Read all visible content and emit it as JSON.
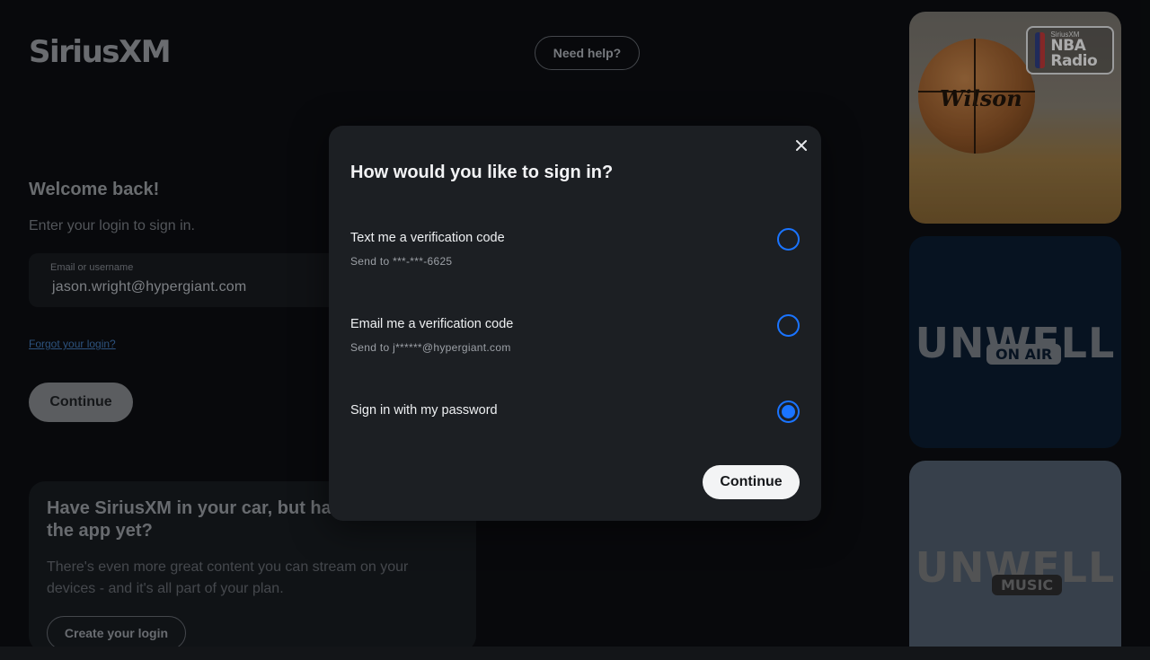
{
  "header": {
    "logo_text": "SiriusXM",
    "help_label": "Need help?"
  },
  "login": {
    "title": "Welcome back!",
    "subtitle": "Enter your login to sign in.",
    "email_label": "Email or username",
    "email_value": "jason.wright@hypergiant.com",
    "forgot_link": "Forgot your login?",
    "continue_label": "Continue"
  },
  "promo": {
    "title": "Have SiriusXM in your car, but haven't set up the app yet?",
    "text": "There's even more great content you can stream on your devices - and it's all part of your plan.",
    "create_label": "Create your login"
  },
  "tiles": {
    "nba": {
      "badge_small": "SiriusXM",
      "badge_big": "NBA Radio",
      "ball_text": "Wilson"
    },
    "air": {
      "word": "UNWELL",
      "sub": "ON AIR"
    },
    "music": {
      "word": "UNWELL",
      "sub": "MUSIC"
    }
  },
  "modal": {
    "title": "How would you like to sign in?",
    "close_icon": "close-icon",
    "options": [
      {
        "label": "Text me a verification code",
        "detail": "Send to ***-***-6625",
        "selected": false
      },
      {
        "label": "Email me a verification code",
        "detail": "Send to j******@hypergiant.com",
        "selected": false
      },
      {
        "label": "Sign in with my password",
        "detail": "",
        "selected": true
      }
    ],
    "continue_label": "Continue"
  },
  "colors": {
    "accent": "#1a74ff",
    "modal_bg": "#1c1f23",
    "page_bg": "#0b0d10"
  }
}
